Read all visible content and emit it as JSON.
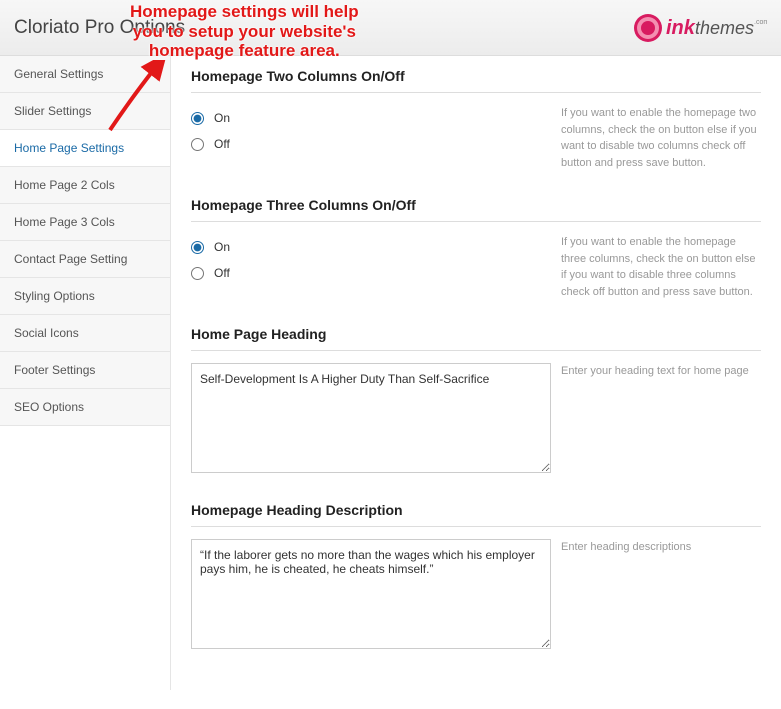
{
  "header": {
    "title": "Cloriato Pro Options"
  },
  "callout": "Homepage settings will help\nyou to setup your website's\nhomepage feature area.",
  "logo": {
    "brand_left": "ink",
    "brand_right": "themes",
    "brand_suffix": ".com"
  },
  "sidebar": {
    "items": [
      {
        "id": "general",
        "label": "General Settings",
        "active": false
      },
      {
        "id": "slider",
        "label": "Slider Settings",
        "active": false
      },
      {
        "id": "home-page",
        "label": "Home Page Settings",
        "active": true
      },
      {
        "id": "home-2cols",
        "label": "Home Page 2 Cols",
        "active": false
      },
      {
        "id": "home-3cols",
        "label": "Home Page 3 Cols",
        "active": false
      },
      {
        "id": "contact",
        "label": "Contact Page Setting",
        "active": false
      },
      {
        "id": "styling",
        "label": "Styling Options",
        "active": false
      },
      {
        "id": "social",
        "label": "Social Icons",
        "active": false
      },
      {
        "id": "footer",
        "label": "Footer Settings",
        "active": false
      },
      {
        "id": "seo",
        "label": "SEO Options",
        "active": false
      }
    ]
  },
  "sections": {
    "two_cols": {
      "title": "Homepage Two Columns On/Off",
      "on_label": "On",
      "off_label": "Off",
      "value": "on",
      "help": "If you want to enable the homepage two columns, check the on button else if you want to disable two columns check off button and press save button."
    },
    "three_cols": {
      "title": "Homepage Three Columns On/Off",
      "on_label": "On",
      "off_label": "Off",
      "value": "on",
      "help": "If you want to enable the homepage three columns, check the on button else if you want to disable three columns check off button and press save button."
    },
    "heading": {
      "title": "Home Page Heading",
      "value": "Self-Development Is A Higher Duty Than Self-Sacrifice",
      "help": "Enter your heading text for home page"
    },
    "heading_desc": {
      "title": "Homepage Heading Description",
      "value": "“If the laborer gets no more than the wages which his employer pays him, he is cheated, he cheats himself.”",
      "help": "Enter heading descriptions"
    }
  }
}
